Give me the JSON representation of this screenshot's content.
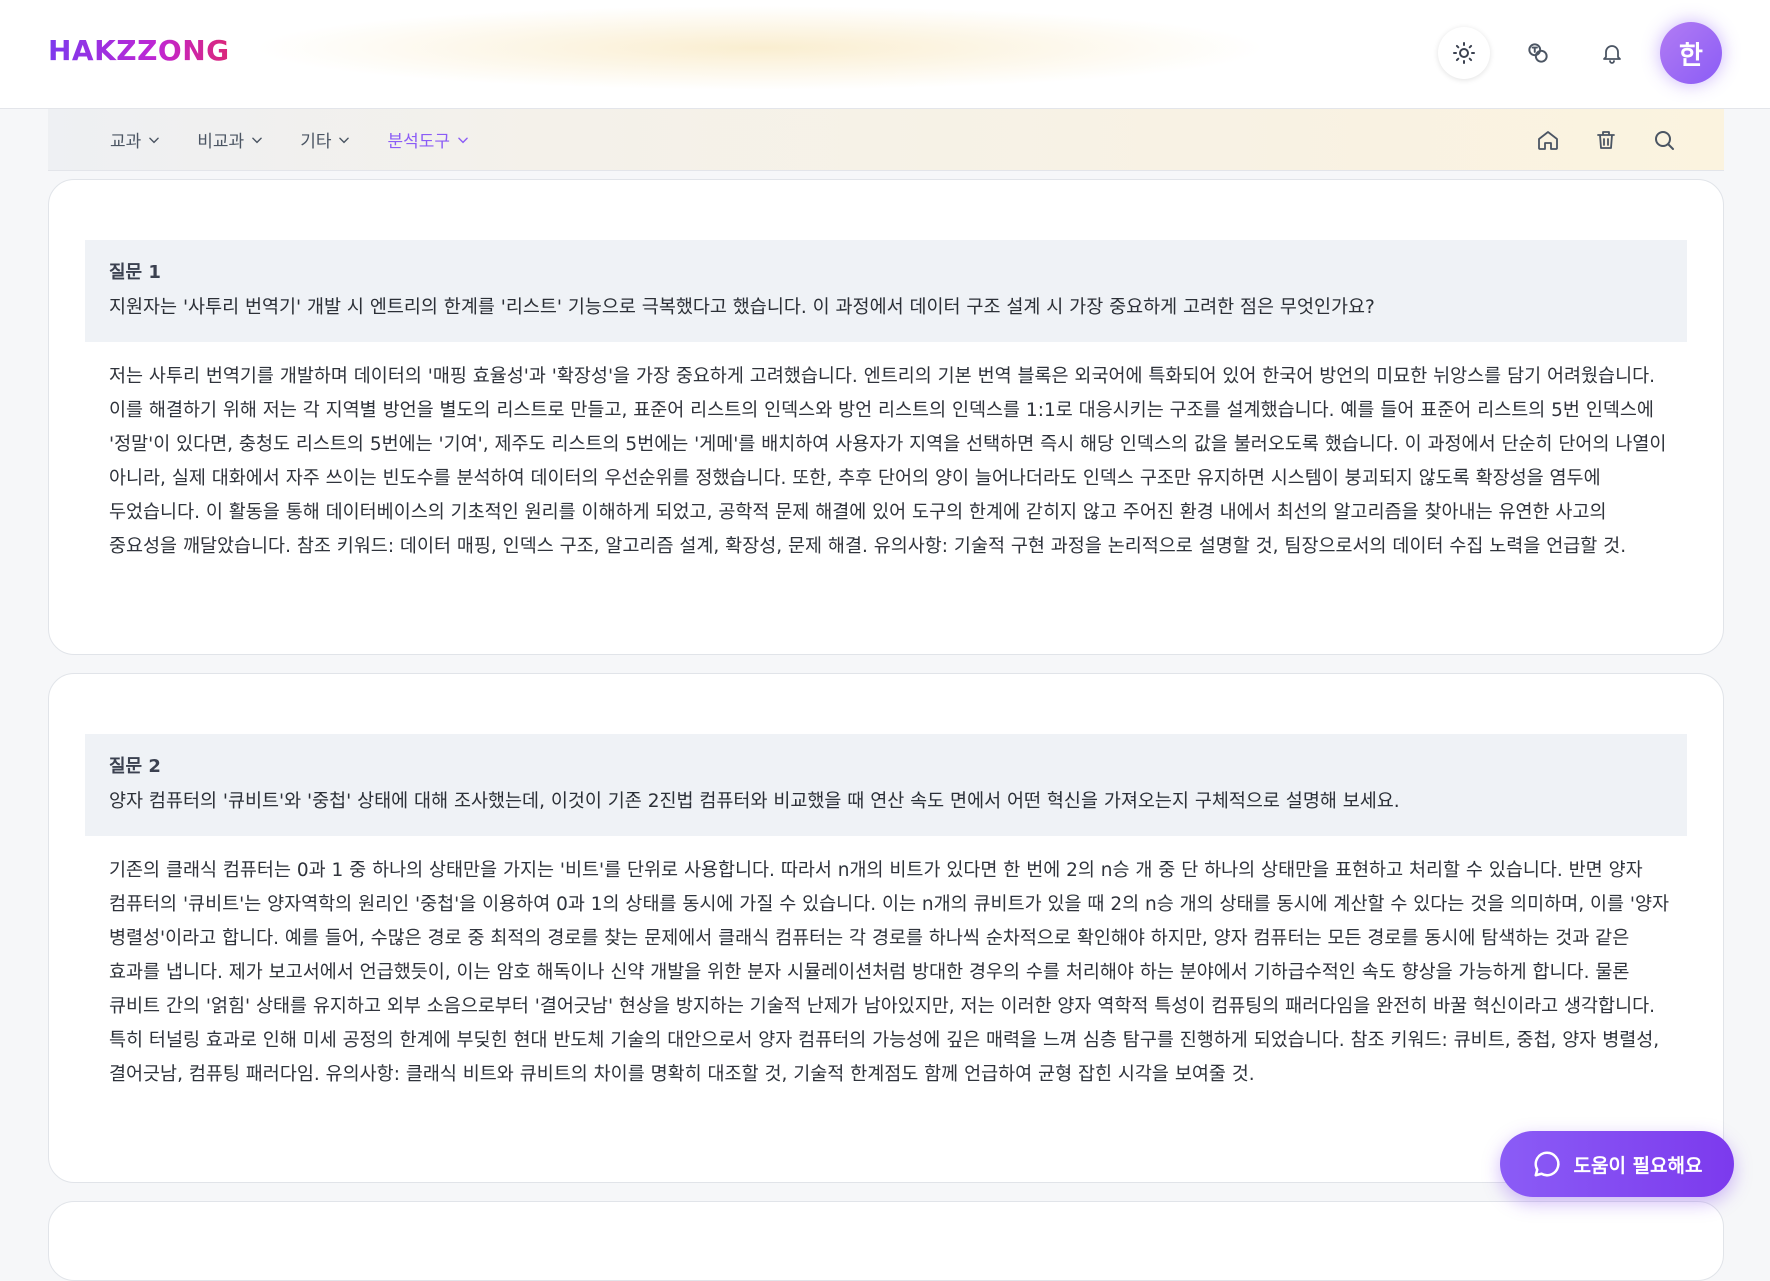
{
  "header": {
    "logo": "HAKZZONG",
    "icons": [
      "sun-icon",
      "translate-icon",
      "bell-icon"
    ],
    "avatar_initial": "한"
  },
  "nav": {
    "menus": [
      {
        "label": "교과",
        "active": false
      },
      {
        "label": "비교과",
        "active": false
      },
      {
        "label": "기타",
        "active": false
      },
      {
        "label": "분석도구",
        "active": true
      }
    ],
    "tools": [
      "home-icon",
      "trash-icon",
      "search-icon"
    ]
  },
  "questions": [
    {
      "label": "질문 1",
      "question": "지원자는 '사투리 번역기' 개발 시 엔트리의 한계를 '리스트' 기능으로 극복했다고 했습니다. 이 과정에서 데이터 구조 설계 시 가장 중요하게 고려한 점은 무엇인가요?",
      "answer": "저는 사투리 번역기를 개발하며 데이터의 '매핑 효율성'과 '확장성'을 가장 중요하게 고려했습니다. 엔트리의 기본 번역 블록은 외국어에 특화되어 있어 한국어 방언의 미묘한 뉘앙스를 담기 어려웠습니다. 이를 해결하기 위해 저는 각 지역별 방언을 별도의 리스트로 만들고, 표준어 리스트의 인덱스와 방언 리스트의 인덱스를 1:1로 대응시키는 구조를 설계했습니다. 예를 들어 표준어 리스트의 5번 인덱스에 '정말'이 있다면, 충청도 리스트의 5번에는 '기여', 제주도 리스트의 5번에는 '게메'를 배치하여 사용자가 지역을 선택하면 즉시 해당 인덱스의 값을 불러오도록 했습니다. 이 과정에서 단순히 단어의 나열이 아니라, 실제 대화에서 자주 쓰이는 빈도수를 분석하여 데이터의 우선순위를 정했습니다. 또한, 추후 단어의 양이 늘어나더라도 인덱스 구조만 유지하면 시스템이 붕괴되지 않도록 확장성을 염두에 두었습니다. 이 활동을 통해 데이터베이스의 기초적인 원리를 이해하게 되었고, 공학적 문제 해결에 있어 도구의 한계에 갇히지 않고 주어진 환경 내에서 최선의 알고리즘을 찾아내는 유연한 사고의 중요성을 깨달았습니다. 참조 키워드: 데이터 매핑, 인덱스 구조, 알고리즘 설계, 확장성, 문제 해결. 유의사항: 기술적 구현 과정을 논리적으로 설명할 것, 팀장으로서의 데이터 수집 노력을 언급할 것."
    },
    {
      "label": "질문 2",
      "question": "양자 컴퓨터의 '큐비트'와 '중첩' 상태에 대해 조사했는데, 이것이 기존 2진법 컴퓨터와 비교했을 때 연산 속도 면에서 어떤 혁신을 가져오는지 구체적으로 설명해 보세요.",
      "answer": "기존의 클래식 컴퓨터는 0과 1 중 하나의 상태만을 가지는 '비트'를 단위로 사용합니다. 따라서 n개의 비트가 있다면 한 번에 2의 n승 개 중 단 하나의 상태만을 표현하고 처리할 수 있습니다. 반면 양자 컴퓨터의 '큐비트'는 양자역학의 원리인 '중첩'을 이용하여 0과 1의 상태를 동시에 가질 수 있습니다. 이는 n개의 큐비트가 있을 때 2의 n승 개의 상태를 동시에 계산할 수 있다는 것을 의미하며, 이를 '양자 병렬성'이라고 합니다. 예를 들어, 수많은 경로 중 최적의 경로를 찾는 문제에서 클래식 컴퓨터는 각 경로를 하나씩 순차적으로 확인해야 하지만, 양자 컴퓨터는 모든 경로를 동시에 탐색하는 것과 같은 효과를 냅니다. 제가 보고서에서 언급했듯이, 이는 암호 해독이나 신약 개발을 위한 분자 시뮬레이션처럼 방대한 경우의 수를 처리해야 하는 분야에서 기하급수적인 속도 향상을 가능하게 합니다. 물론 큐비트 간의 '얽힘' 상태를 유지하고 외부 소음으로부터 '결어긋남' 현상을 방지하는 기술적 난제가 남아있지만, 저는 이러한 양자 역학적 특성이 컴퓨팅의 패러다임을 완전히 바꿀 혁신이라고 생각합니다. 특히 터널링 효과로 인해 미세 공정의 한계에 부딪힌 현대 반도체 기술의 대안으로서 양자 컴퓨터의 가능성에 깊은 매력을 느껴 심층 탐구를 진행하게 되었습니다. 참조 키워드: 큐비트, 중첩, 양자 병렬성, 결어긋남, 컴퓨팅 패러다임. 유의사항: 클래식 비트와 큐비트의 차이를 명확히 대조할 것, 기술적 한계점도 함께 언급하여 균형 잡힌 시각을 보여줄 것."
    }
  ],
  "help_button": {
    "label": "도움이 필요해요",
    "icon": "chat-bubble-icon"
  },
  "colors": {
    "accent": "#8b5cf6",
    "question_bg": "#eff2f6"
  }
}
